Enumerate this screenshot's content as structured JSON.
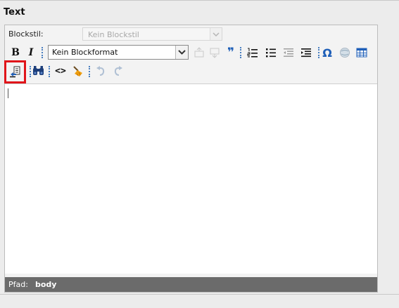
{
  "section": {
    "title": "Text"
  },
  "editor": {
    "blockstil": {
      "label": "Blockstil:",
      "value": "Kein Blockstil"
    },
    "blockformat": {
      "value": "Kein Blockformat"
    },
    "toolbar": {
      "bold": "B",
      "italic": "I",
      "blockquote": "❞",
      "special_char": "Ω",
      "source": "<>"
    },
    "path": {
      "label": "Pfad:",
      "value": "body"
    }
  },
  "colors": {
    "highlight": "#e0151a",
    "path_bar": "#6b6b6b",
    "accent": "#1f5fb8"
  }
}
